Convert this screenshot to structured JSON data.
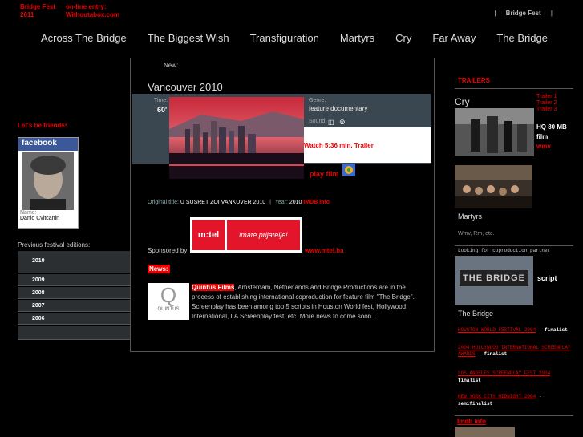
{
  "header": {
    "brand_line1": "Bridge Fest",
    "brand_line2": "2011",
    "entry_line1": "on-line entry:",
    "entry_line2": "Withoutabox.com",
    "topright_link": "Bridge Fest",
    "sep": "|"
  },
  "nav": [
    "Across The Bridge",
    "The Biggest Wish",
    "Transfiguration",
    "Martyrs",
    "Cry",
    "Far Away",
    "The Bridge"
  ],
  "left": {
    "friends": "Let's be friends!",
    "facebook": "facebook",
    "name_label": "Name:",
    "name_value": "Danio Cvitcanin",
    "prev_label": "Previous festival editions:",
    "years": [
      "2010",
      "2009",
      "2008",
      "2007",
      "2006"
    ]
  },
  "center": {
    "new_label": "New:",
    "title": "Vancouver 2010",
    "time_label": "Time:",
    "time_value": "60'",
    "genre_label": "Genre:",
    "genre_value": "feature documentary",
    "sound_label": "Sound:",
    "watch": "Watch 5:36 min. Trailer",
    "play": "play film",
    "orig_label": "Original title:",
    "orig_value": "U SUSRET ZOI VANKUVER 2010",
    "year_label": "Year:",
    "year_value": "2010",
    "imdb": "IMDB info",
    "sponsored": "Sponsored by:",
    "sponsor_brand": "m:tel",
    "sponsor_slogan": "imate prijatelje!",
    "sponsor_url": "www.mtel.ba",
    "news_label": "News:",
    "quintus": "QUINTUS",
    "news_lead": "Quintus Films",
    "news_text": ", Amsterdam, Netherlands and Bridge Productions are in the process of establishing international coproduction for feature film \"The Bridge\". Screenplay has been among top 5 scripts in Houston World fest, Hollywood International, LA Screenplay fest, etc. More news to come soon..."
  },
  "right": {
    "trailers": "TRAILERS",
    "cry": "Cry",
    "trailer1": "Trailer 1",
    "trailer2": "Trailer 2",
    "trailer3": "Trailer 3",
    "hq1": "HQ 80 MB",
    "hq2": "film",
    "hq3": "wmv",
    "martyrs": "Martyrs",
    "formats": "Wmv, Rm, etc.",
    "looking": "Looking for coproduction partner",
    "poster_text": "THE BRIDGE",
    "script": "script",
    "bridge": "The Bridge",
    "f1": "HOUSTON WORLD FESTIVAL 2004",
    "f1b": "finalist",
    "f2": "2004 HOLLYWOOD INTERNATIONAL SCREENPLAY AWARDS",
    "f2b": "finalist",
    "f3": "LOS ANGELES SCREENPLAY FEST 2004",
    "f3b": "finalist",
    "f4": "NEW YORK CITY MIDNIGHT 2004",
    "f4b": "semifinalist",
    "imdb": "Imdb info",
    "dash": "-"
  }
}
